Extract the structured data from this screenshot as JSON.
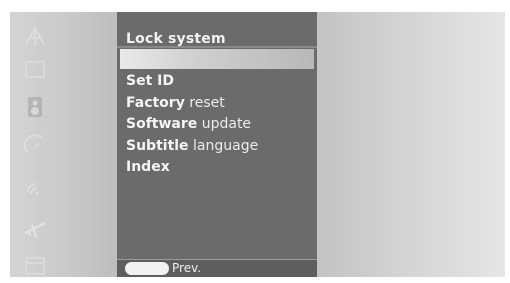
{
  "menu": {
    "title": "Lock system",
    "items": [
      {
        "bold": "Set ID",
        "light": ""
      },
      {
        "bold": "Factory",
        "light": " reset"
      },
      {
        "bold": "Software",
        "light": " update"
      },
      {
        "bold": "Subtitle",
        "light": " language"
      },
      {
        "bold": "Index",
        "light": ""
      }
    ]
  },
  "footer": {
    "prev_label": "Prev."
  },
  "rail_icons": [
    "antenna-icon",
    "screen-icon",
    "speaker-icon",
    "dial-icon",
    "signal-icon",
    "plane-icon",
    "window-icon"
  ]
}
